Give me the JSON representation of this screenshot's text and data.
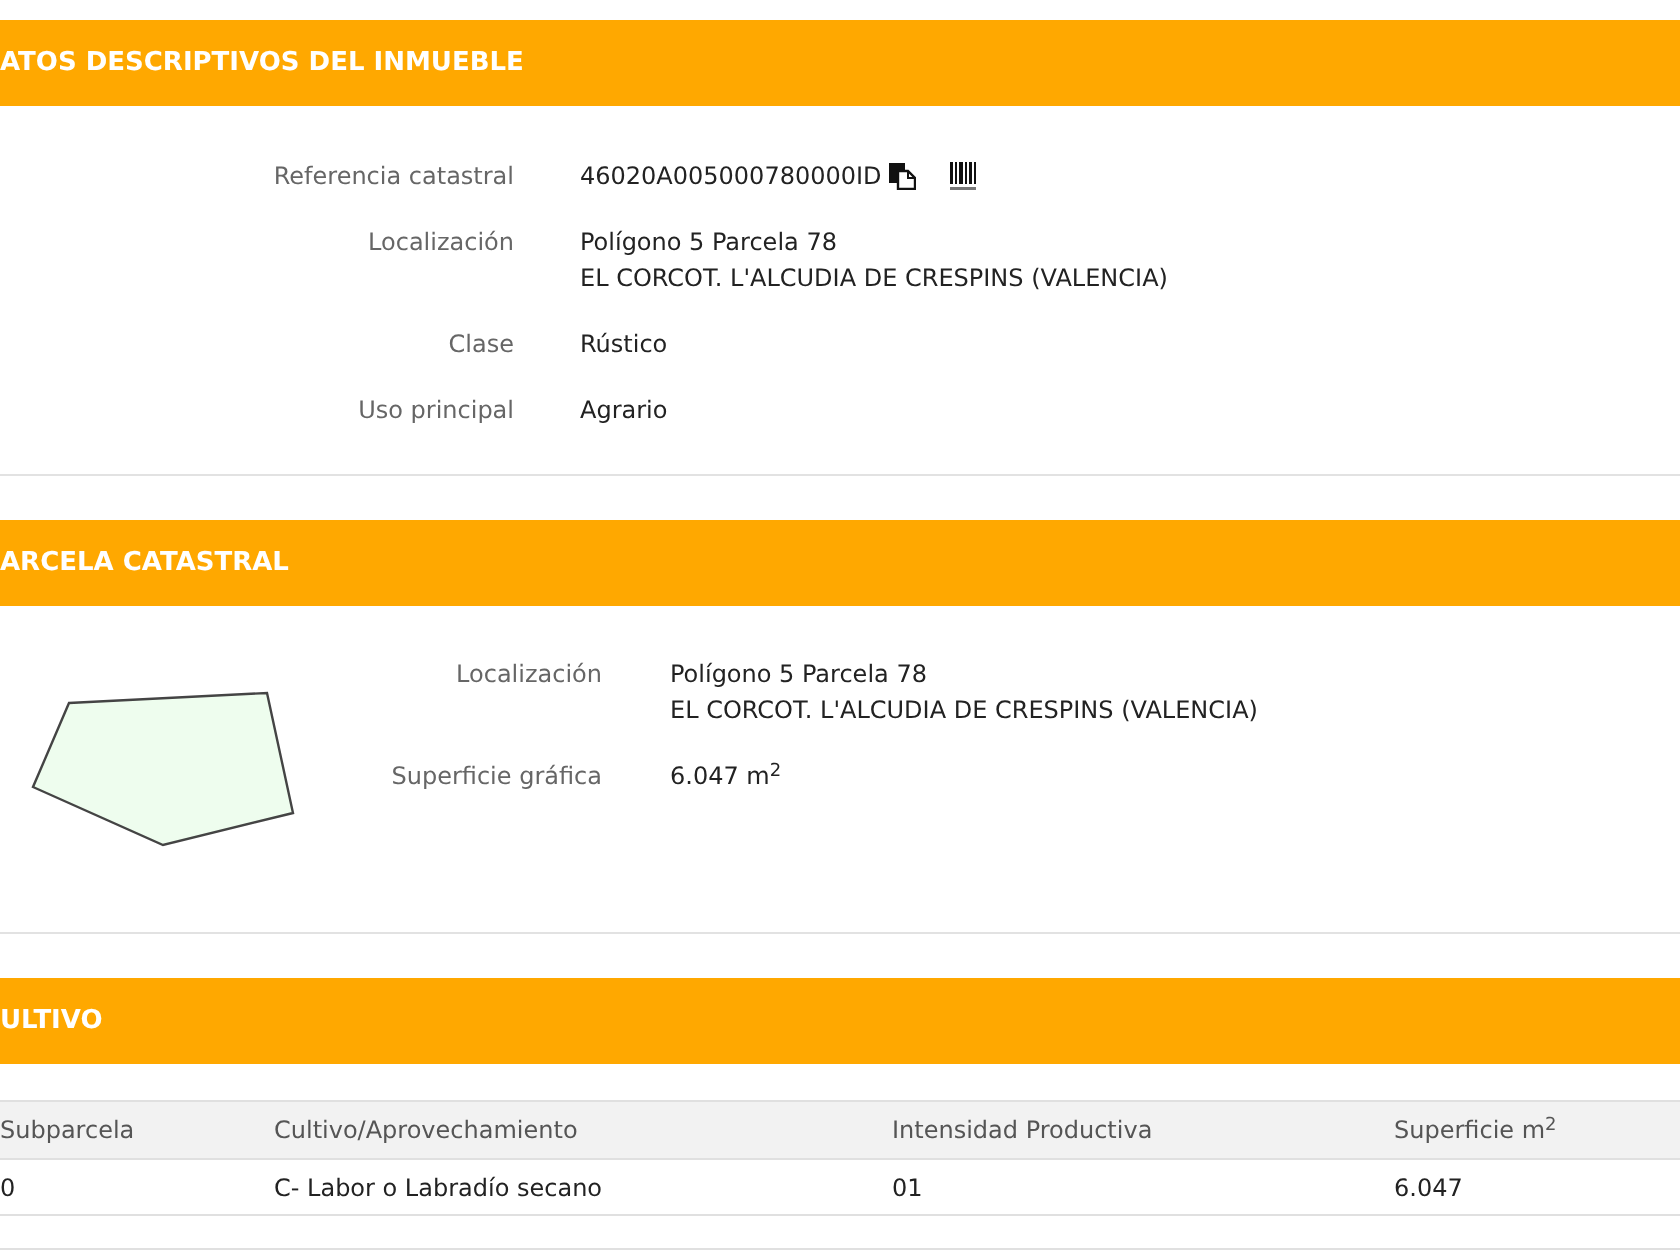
{
  "inmueble": {
    "title": "ATOS DESCRIPTIVOS DEL INMUEBLE",
    "fields": [
      {
        "kind": "reference",
        "label": "Referencia catastral",
        "lines": [
          "46020A005000780000ID"
        ]
      },
      {
        "kind": "text",
        "label": "Localización",
        "lines": [
          "Polígono 5 Parcela 78",
          "EL CORCOT. L'ALCUDIA DE CRESPINS (VALENCIA)"
        ]
      },
      {
        "kind": "text",
        "label": "Clase",
        "lines": [
          "Rústico"
        ]
      },
      {
        "kind": "text",
        "label": "Uso principal",
        "lines": [
          "Agrario"
        ]
      }
    ]
  },
  "parcela": {
    "title": "ARCELA CATASTRAL",
    "fields": [
      {
        "kind": "text",
        "label": "Localización",
        "lines": [
          "Polígono 5 Parcela 78",
          "EL CORCOT. L'ALCUDIA DE CRESPINS (VALENCIA)"
        ]
      },
      {
        "kind": "text",
        "label": "Superficie gráfica",
        "lines": [
          "6.047 m$^{2}$"
        ]
      }
    ]
  },
  "cultivo": {
    "title": "ULTIVO",
    "table": {
      "columns": [
        "Subparcela",
        "Cultivo/Aprovechamiento",
        "Intensidad Productiva",
        "Superficie m$^{2}$"
      ],
      "rows": [
        [
          "0",
          "C- Labor o Labradío secano",
          "01",
          "6.047"
        ]
      ]
    }
  }
}
